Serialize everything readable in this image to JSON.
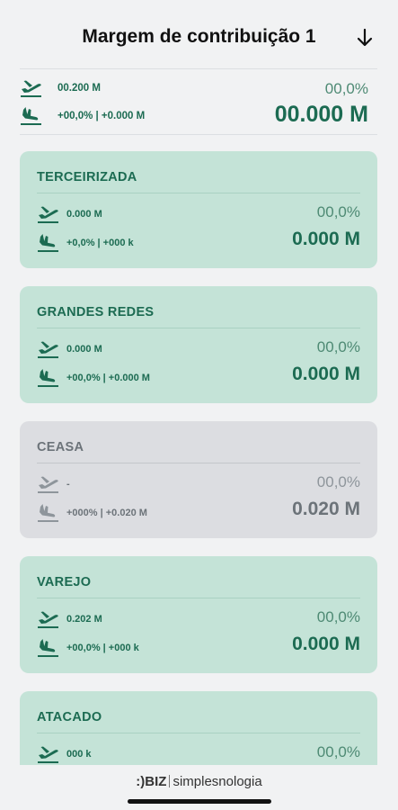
{
  "header": {
    "title": "Margem de contribuição 1",
    "action_icon": "arrow-down-icon"
  },
  "summary": {
    "departure_value": "00.200 M",
    "arrival_value": "+00,0% | +0.000 M",
    "percent": "00,0%",
    "total": "00.000 M"
  },
  "cards": [
    {
      "title": "TERCEIRIZADA",
      "departure_value": "0.000 M",
      "arrival_value": "+0,0% | +000 k",
      "percent": "00,0%",
      "total": "0.000 M",
      "state": "active"
    },
    {
      "title": "GRANDES REDES",
      "departure_value": "0.000 M",
      "arrival_value": "+00,0% | +0.000 M",
      "percent": "00,0%",
      "total": "0.000 M",
      "state": "active"
    },
    {
      "title": "CEASA",
      "departure_value": "-",
      "arrival_value": "+000% | +0.020 M",
      "percent": "00,0%",
      "total": "0.020 M",
      "state": "inactive"
    },
    {
      "title": "VAREJO",
      "departure_value": "0.202 M",
      "arrival_value": "+00,0% | +000 k",
      "percent": "00,0%",
      "total": "0.000 M",
      "state": "active"
    },
    {
      "title": "ATACADO",
      "departure_value": "000 k",
      "percent": "00,0%",
      "state": "active"
    }
  ],
  "icons": {
    "departure": "plane-departure-icon",
    "arrival": "plane-arrival-icon"
  },
  "footer": {
    "brand_logo": ":)BIZ",
    "brand_name": "simplesnologia"
  },
  "colors": {
    "accent": "#1c6b52",
    "card_active": "#c4e3d7",
    "card_inactive": "#dcdde1",
    "background": "#f1f2f3"
  }
}
